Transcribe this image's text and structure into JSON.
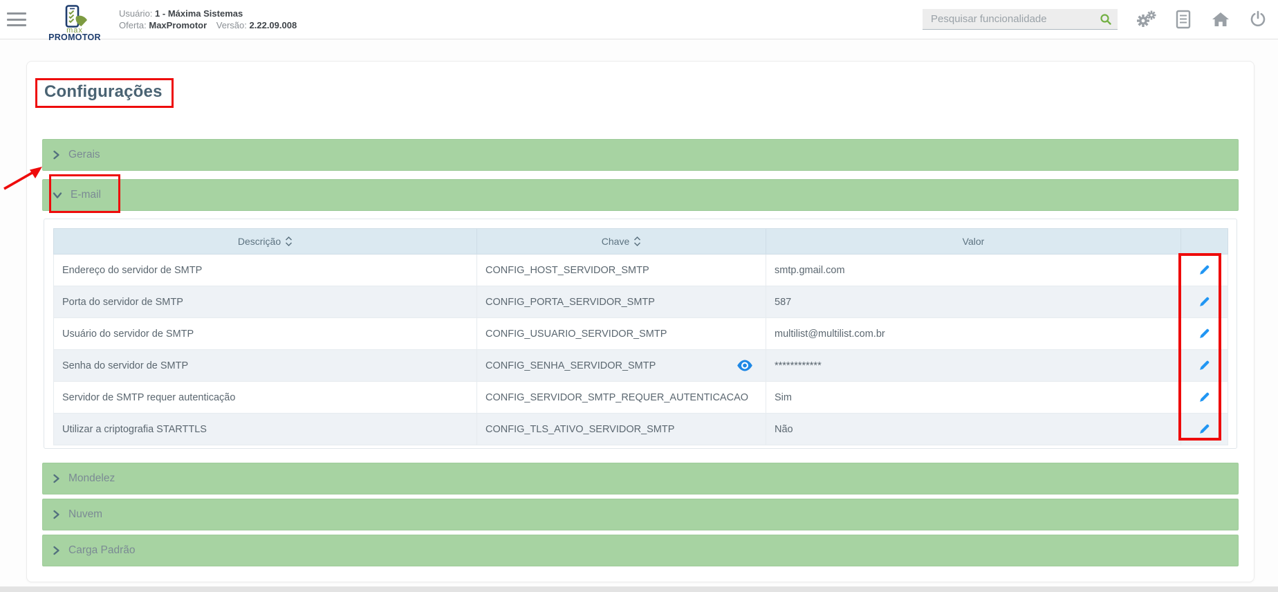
{
  "header": {
    "logo": {
      "line1": "max",
      "line2": "PROMOTOR"
    },
    "user_label": "Usuário:",
    "user_value": "1 - Máxima Sistemas",
    "offer_label": "Oferta:",
    "offer_value": "MaxPromotor",
    "version_label": "Versão:",
    "version_value": "2.22.09.008",
    "search_placeholder": "Pesquisar funcionalidade",
    "icons": [
      "menu",
      "search",
      "settings-gears",
      "document",
      "home",
      "power"
    ]
  },
  "page": {
    "title": "Configurações",
    "accordions": [
      {
        "label": "Gerais",
        "state": "collapsed"
      },
      {
        "label": "E-mail",
        "state": "expanded"
      },
      {
        "label": "Mondelez",
        "state": "collapsed"
      },
      {
        "label": "Nuvem",
        "state": "collapsed"
      },
      {
        "label": "Carga Padrão",
        "state": "collapsed"
      }
    ]
  },
  "table": {
    "headers": {
      "descricao": "Descrição",
      "chave": "Chave",
      "valor": "Valor"
    },
    "sortable_columns": [
      "Descrição",
      "Chave"
    ],
    "rows": [
      {
        "descricao": "Endereço do servidor de SMTP",
        "chave": "CONFIG_HOST_SERVIDOR_SMTP",
        "valor": "smtp.gmail.com"
      },
      {
        "descricao": "Porta do servidor de SMTP",
        "chave": "CONFIG_PORTA_SERVIDOR_SMTP",
        "valor": "587"
      },
      {
        "descricao": "Usuário do servidor de SMTP",
        "chave": "CONFIG_USUARIO_SERVIDOR_SMTP",
        "valor": "multilist@multilist.com.br"
      },
      {
        "descricao": "Senha do servidor de SMTP",
        "chave": "CONFIG_SENHA_SERVIDOR_SMTP",
        "valor": "************",
        "has_eye_icon": true
      },
      {
        "descricao": "Servidor de SMTP requer autenticação",
        "chave": "CONFIG_SERVIDOR_SMTP_REQUER_AUTENTICACAO",
        "valor": "Sim"
      },
      {
        "descricao": "Utilizar a criptografia STARTTLS",
        "chave": "CONFIG_TLS_ATIVO_SERVIDOR_SMTP",
        "valor": "Não"
      }
    ]
  },
  "colors": {
    "accordion_green": "#a7d3a2",
    "table_header_bg": "#dbe9f1",
    "edit_icon_blue": "#2196f3",
    "eye_icon_blue": "#1e88e5",
    "annotation_red": "#ee0b0b",
    "logo_navy": "#1e3d6e",
    "logo_green": "#7d9b41",
    "search_icon_green": "#72b043"
  }
}
